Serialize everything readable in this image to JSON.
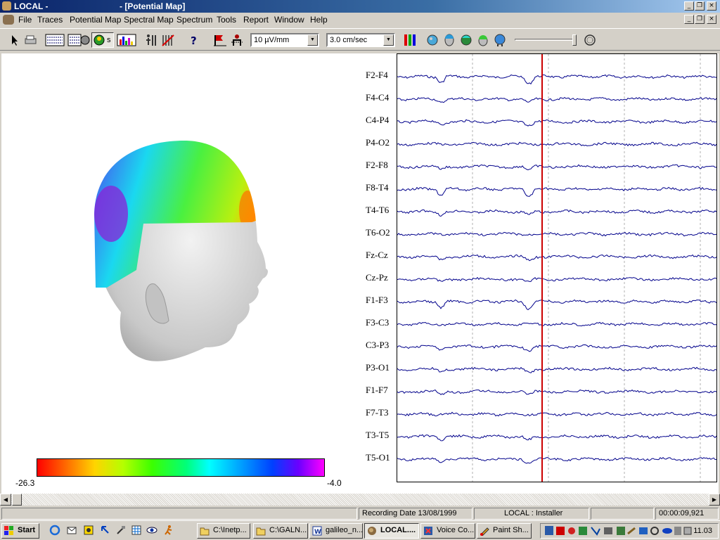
{
  "window": {
    "app_title": "LOCAL -",
    "doc_title": "- [Potential Map]"
  },
  "menu": [
    "File",
    "Traces",
    "Potential Map",
    "Spectral Map",
    "Spectrum",
    "Tools",
    "Report",
    "Window",
    "Help"
  ],
  "toolbar": {
    "sensitivity": "10 µV/mm",
    "speed": "3.0 cm/sec",
    "mode_button_label": "s"
  },
  "potential_map": {
    "min_label": "-26.3",
    "max_label": "-4.0"
  },
  "traces": {
    "channels": [
      "F2-F4",
      "F4-C4",
      "C4-P4",
      "P4-O2",
      "F2-F8",
      "F8-T4",
      "T4-T6",
      "T6-O2",
      "Fz-Cz",
      "Cz-Pz",
      "F1-F3",
      "F3-C3",
      "C3-P3",
      "P3-O1",
      "F1-F7",
      "F7-T3",
      "T3-T5",
      "T5-O1"
    ],
    "trace_color": "#00008b",
    "cursor_color": "#cc0000"
  },
  "status": {
    "recording_date": "Recording Date 13/08/1999",
    "user": "LOCAL : Installer",
    "time": "00:00:09,921"
  },
  "taskbar": {
    "start": "Start",
    "tasks": [
      "C:\\Inetp...",
      "C:\\GALN...",
      "galileo_n...",
      "LOCAL....",
      "Voice Co...",
      "Paint Sh..."
    ],
    "clock": "11.03"
  }
}
